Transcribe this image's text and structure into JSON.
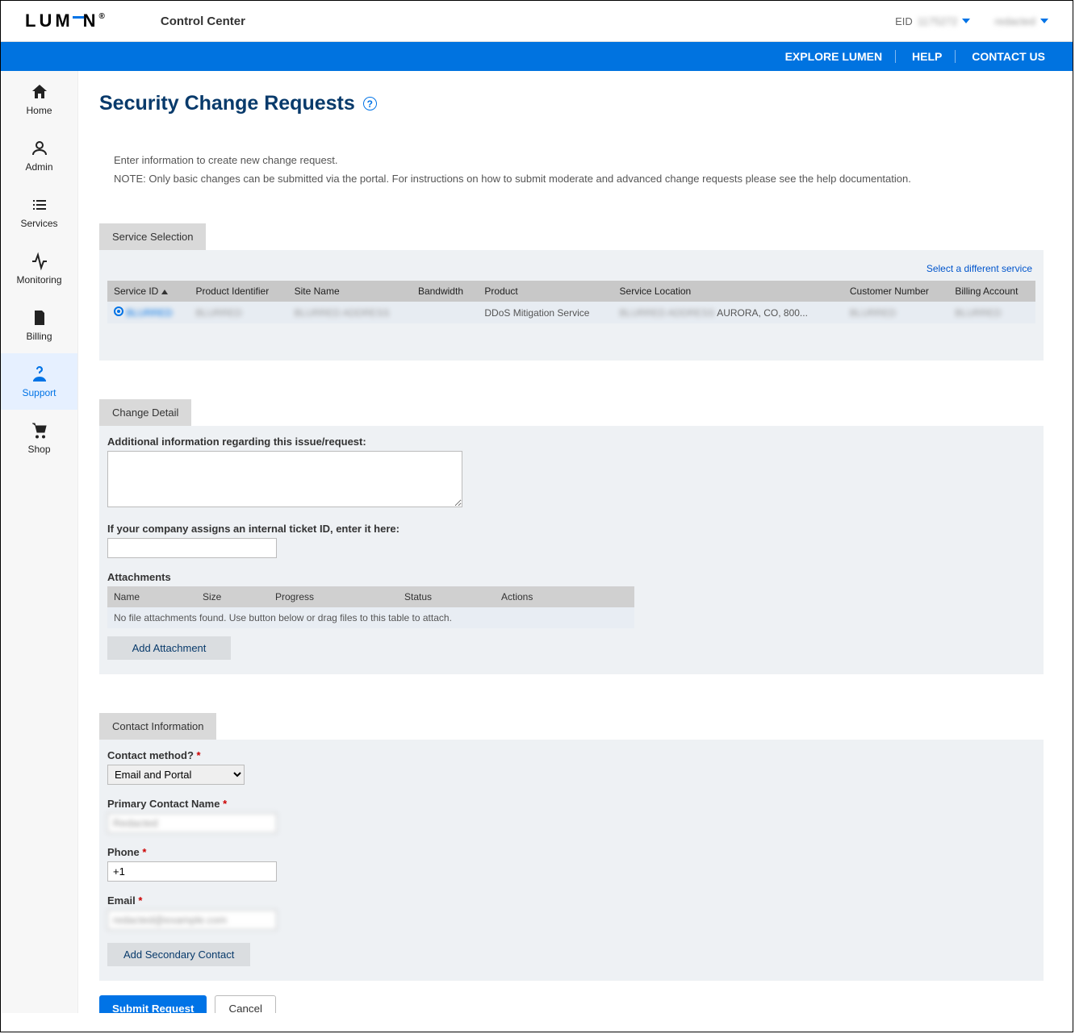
{
  "header": {
    "logo_text": "LUMEN",
    "title": "Control Center",
    "eid_label": "EID",
    "eid_value": "1175272",
    "user_name": "redacted"
  },
  "bluebar": {
    "explore": "EXPLORE LUMEN",
    "help": "HELP",
    "contact": "CONTACT US"
  },
  "sidebar": {
    "items": [
      {
        "label": "Home"
      },
      {
        "label": "Admin"
      },
      {
        "label": "Services"
      },
      {
        "label": "Monitoring"
      },
      {
        "label": "Billing"
      },
      {
        "label": "Support"
      },
      {
        "label": "Shop"
      }
    ]
  },
  "page": {
    "title": "Security Change Requests",
    "instruction": "Enter information to create new change request.",
    "note": "NOTE: Only basic changes can be submitted via the portal. For instructions on how to submit moderate and advanced change requests please see the help documentation."
  },
  "service_section": {
    "tab": "Service Selection",
    "select_different": "Select a different service",
    "columns": {
      "service_id": "Service ID",
      "product_identifier": "Product Identifier",
      "site_name": "Site Name",
      "bandwidth": "Bandwidth",
      "product": "Product",
      "service_location": "Service Location",
      "customer_number": "Customer Number",
      "billing_account": "Billing Account"
    },
    "row": {
      "service_id": "BLURRED",
      "product_identifier": "BLURRED",
      "site_name": "BLURRED ADDRESS",
      "bandwidth": "",
      "product": "DDoS Mitigation Service",
      "service_location": " AURORA, CO, 800...",
      "service_location_prefix": "BLURRED ADDRESS",
      "customer_number": "BLURRED",
      "billing_account": "BLURRED"
    }
  },
  "change_detail": {
    "tab": "Change Detail",
    "additional_label": "Additional information regarding this issue/request:",
    "ticket_label": "If your company assigns an internal ticket ID, enter it here:",
    "attachments_label": "Attachments",
    "att_columns": {
      "name": "Name",
      "size": "Size",
      "progress": "Progress",
      "status": "Status",
      "actions": "Actions"
    },
    "no_attachments": "No file attachments found. Use button below or drag files to this table to attach.",
    "add_attachment": "Add Attachment"
  },
  "contact": {
    "tab": "Contact Information",
    "method_label": "Contact method?",
    "method_value": "Email and Portal",
    "primary_name_label": "Primary Contact Name",
    "primary_name_value": "Redacted",
    "phone_label": "Phone",
    "phone_value": "+1 ",
    "email_label": "Email",
    "email_value": "redacted@example.com",
    "add_secondary": "Add Secondary Contact"
  },
  "actions": {
    "submit": "Submit Request",
    "cancel": "Cancel"
  }
}
